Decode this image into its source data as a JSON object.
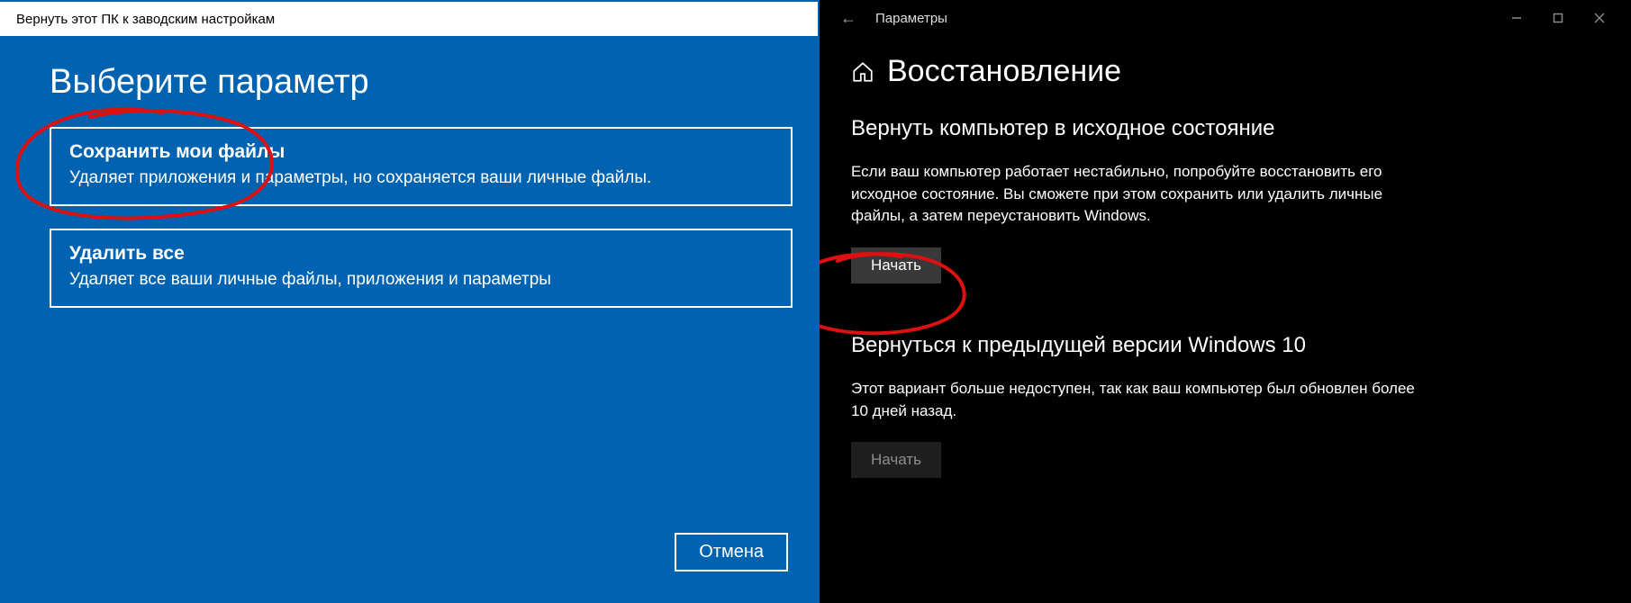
{
  "blue": {
    "titlebar": "Вернуть этот ПК к заводским настройкам",
    "heading": "Выберите параметр",
    "option1": {
      "title": "Сохранить мои файлы",
      "desc": "Удаляет приложения и параметры, но сохраняется ваши личные файлы."
    },
    "option2": {
      "title": "Удалить все",
      "desc": "Удаляет все ваши личные файлы, приложения и параметры"
    },
    "cancel": "Отмена"
  },
  "settings": {
    "app_name": "Параметры",
    "page_title": "Восстановление",
    "section1": {
      "title": "Вернуть компьютер в исходное состояние",
      "desc": "Если ваш компьютер работает нестабильно, попробуйте восстановить его исходное состояние. Вы сможете при этом сохранить или удалить личные файлы, а затем переустановить Windows.",
      "button": "Начать"
    },
    "section2": {
      "title": "Вернуться к предыдущей версии Windows 10",
      "desc": "Этот вариант больше недоступен, так как ваш компьютер был обновлен более 10 дней назад.",
      "button": "Начать"
    }
  }
}
